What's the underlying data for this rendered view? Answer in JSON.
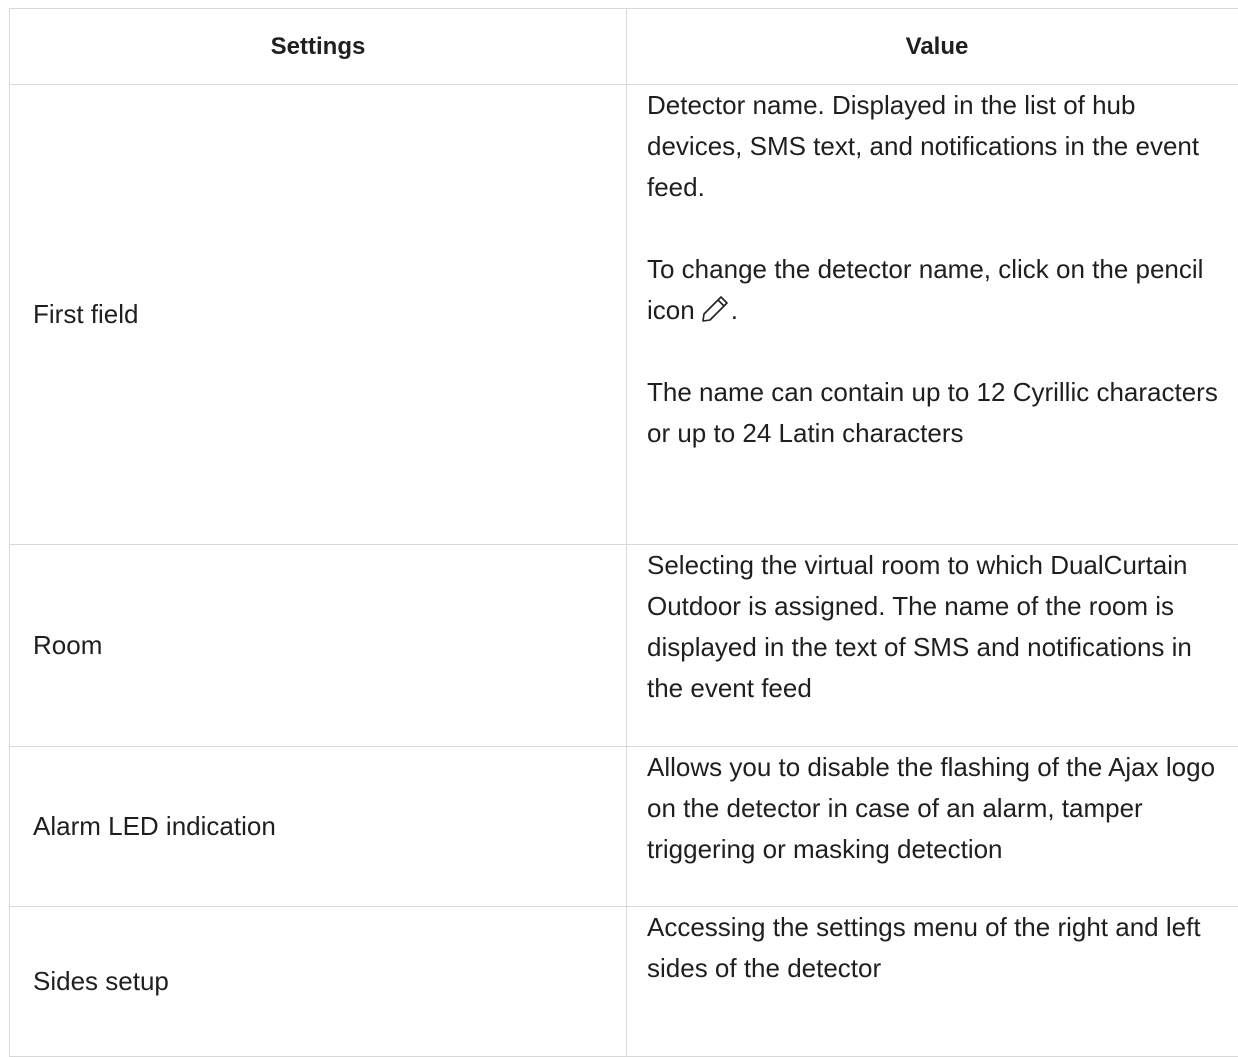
{
  "table": {
    "headers": {
      "settings": "Settings",
      "value": "Value"
    },
    "rows": [
      {
        "setting": "First field",
        "paragraphs": [
          "Detector name. Displayed in the list of hub devices, SMS text, and notifications in the event feed.",
          "To change the detector name, click on the pencil icon",
          "The name can contain up to 12 Cyrillic characters or up to 24 Latin characters"
        ],
        "punctuation_after_icon": "."
      },
      {
        "setting": "Room",
        "paragraphs": [
          "Selecting the virtual room to which DualCurtain Outdoor is assigned. The name of the room is displayed in the text of SMS and notifications in the event feed"
        ]
      },
      {
        "setting": "Alarm LED indication",
        "paragraphs": [
          "Allows you to disable the flashing of the Ajax logo on the detector in case of an alarm, tamper triggering or masking detection"
        ]
      },
      {
        "setting": "Sides setup",
        "paragraphs": [
          "Accessing the settings menu of the right and left sides of the detector"
        ]
      }
    ]
  },
  "icons": {
    "pencil": "pencil-icon"
  },
  "colors": {
    "border": "#d8d8d8",
    "text": "#1f1f1f"
  }
}
